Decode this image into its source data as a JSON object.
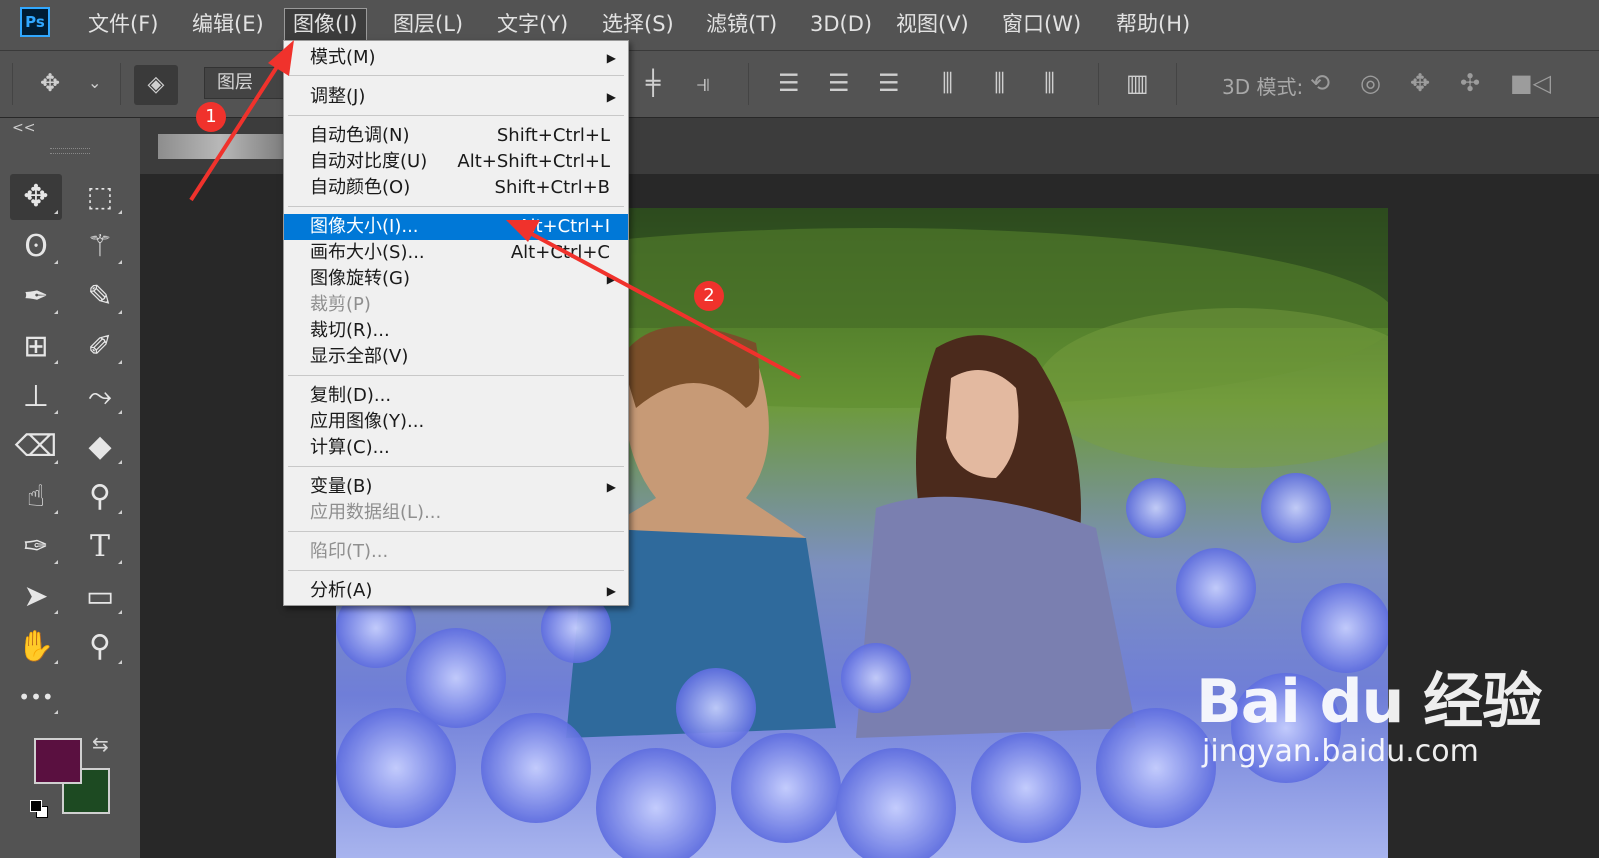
{
  "app": {
    "logo": "Ps"
  },
  "menubar": {
    "items": [
      "文件(F)",
      "编辑(E)",
      "图像(I)",
      "图层(L)",
      "文字(Y)",
      "选择(S)",
      "滤镜(T)",
      "3D(D)",
      "视图(V)",
      "窗口(W)",
      "帮助(H)"
    ],
    "active": "图像(I)"
  },
  "options": {
    "layers_field": "图层",
    "mode_3d_label": "3D 模式:"
  },
  "panel": {
    "collapse": "<<"
  },
  "tools": [
    "move-tool",
    "marquee-tool",
    "lasso-tool",
    "magic-wand-tool",
    "pen-path-tool",
    "eyedropper-tool",
    "crop-frame-tool",
    "brush-tool",
    "stamp-tool",
    "history-brush-tool",
    "eraser-tool",
    "paint-bucket-tool",
    "smudge-tool",
    "dodge-tool",
    "pen-tool",
    "type-tool",
    "path-select-tool",
    "rectangle-tool",
    "hand-tool",
    "zoom-tool",
    "more-tools"
  ],
  "type_tool_glyph": "T",
  "more_tools_glyph": "•••",
  "colors": {
    "foreground": "#5a1040",
    "background": "#1d4a22",
    "highlight": "#0078d7",
    "annotation": "#f0322c"
  },
  "image_menu": {
    "items": [
      {
        "label": "模式(M)",
        "shortcut": "",
        "submenu": true,
        "disabled": false
      },
      {
        "label": "调整(J)",
        "shortcut": "",
        "submenu": true,
        "disabled": false
      },
      {
        "label": "自动色调(N)",
        "shortcut": "Shift+Ctrl+L",
        "submenu": false,
        "disabled": false
      },
      {
        "label": "自动对比度(U)",
        "shortcut": "Alt+Shift+Ctrl+L",
        "submenu": false,
        "disabled": false
      },
      {
        "label": "自动颜色(O)",
        "shortcut": "Shift+Ctrl+B",
        "submenu": false,
        "disabled": false
      },
      {
        "label": "图像大小(I)...",
        "shortcut": "Alt+Ctrl+I",
        "submenu": false,
        "disabled": false,
        "highlighted": true
      },
      {
        "label": "画布大小(S)...",
        "shortcut": "Alt+Ctrl+C",
        "submenu": false,
        "disabled": false
      },
      {
        "label": "图像旋转(G)",
        "shortcut": "",
        "submenu": true,
        "disabled": false
      },
      {
        "label": "裁剪(P)",
        "shortcut": "",
        "submenu": false,
        "disabled": true
      },
      {
        "label": "裁切(R)...",
        "shortcut": "",
        "submenu": false,
        "disabled": false
      },
      {
        "label": "显示全部(V)",
        "shortcut": "",
        "submenu": false,
        "disabled": false
      },
      {
        "label": "复制(D)...",
        "shortcut": "",
        "submenu": false,
        "disabled": false
      },
      {
        "label": "应用图像(Y)...",
        "shortcut": "",
        "submenu": false,
        "disabled": false
      },
      {
        "label": "计算(C)...",
        "shortcut": "",
        "submenu": false,
        "disabled": false
      },
      {
        "label": "变量(B)",
        "shortcut": "",
        "submenu": true,
        "disabled": false
      },
      {
        "label": "应用数据组(L)...",
        "shortcut": "",
        "submenu": false,
        "disabled": true
      },
      {
        "label": "陷印(T)...",
        "shortcut": "",
        "submenu": false,
        "disabled": true
      },
      {
        "label": "分析(A)",
        "shortcut": "",
        "submenu": true,
        "disabled": false
      }
    ]
  },
  "annotations": {
    "badge1": "1",
    "badge2": "2"
  },
  "watermark": {
    "logo": "Bai du 经验",
    "url": "jingyan.baidu.com"
  }
}
